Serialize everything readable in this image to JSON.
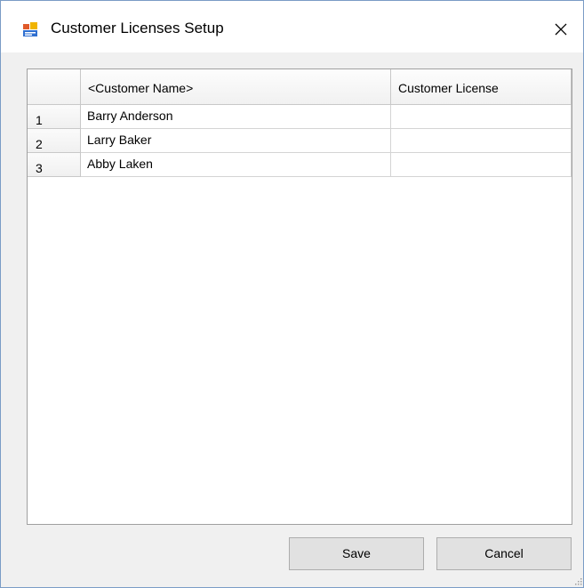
{
  "window": {
    "title": "Customer Licenses Setup",
    "app_icon": "form-app-icon",
    "close_icon": "close-icon"
  },
  "grid": {
    "columns": [
      "<Customer Name>",
      "Customer License"
    ],
    "rows": [
      {
        "number": "1",
        "customer_name": "Barry Anderson",
        "customer_license": ""
      },
      {
        "number": "2",
        "customer_name": "Larry Baker",
        "customer_license": ""
      },
      {
        "number": "3",
        "customer_name": "Abby Laken",
        "customer_license": ""
      }
    ]
  },
  "buttons": {
    "save_label": "Save",
    "cancel_label": "Cancel"
  },
  "colors": {
    "window_border": "#7a9cc6",
    "background": "#f0f0f0",
    "button_face": "#e1e1e1"
  }
}
